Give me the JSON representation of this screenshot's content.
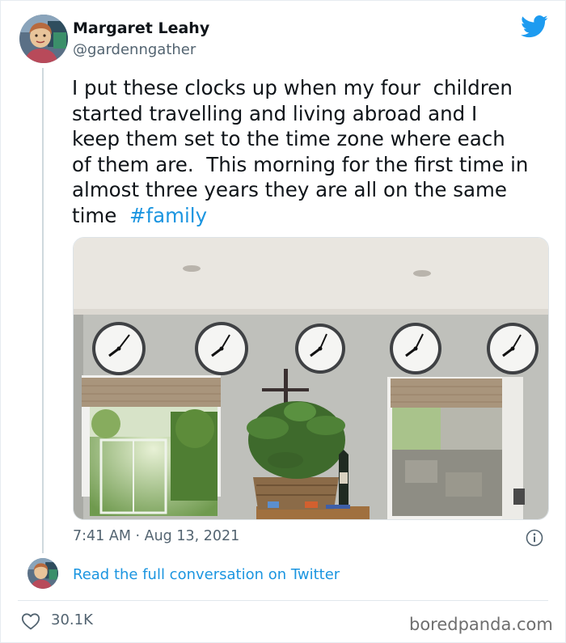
{
  "author": {
    "name": "Margaret Leahy",
    "handle": "@gardenngather"
  },
  "tweet": {
    "lines": [
      "I put these clocks up when my four  children",
      "started travelling and living abroad and I",
      "keep them set to the time zone where each",
      "of them are.  This morning for the first time in",
      "almost three years they are all on the same",
      "time  "
    ],
    "hashtag": "#family"
  },
  "meta": {
    "timestamp": "7:41 AM · Aug 13, 2021"
  },
  "link": {
    "read_conversation": "Read the full conversation on Twitter"
  },
  "stats": {
    "likes": "30.1K"
  },
  "watermark": "boredpanda.com",
  "icons": {
    "brand": "twitter-bird-icon",
    "info": "info-icon",
    "like": "heart-icon"
  },
  "colors": {
    "accent": "#1b95e0",
    "muted": "#536471",
    "brand": "#1d9bf0"
  }
}
